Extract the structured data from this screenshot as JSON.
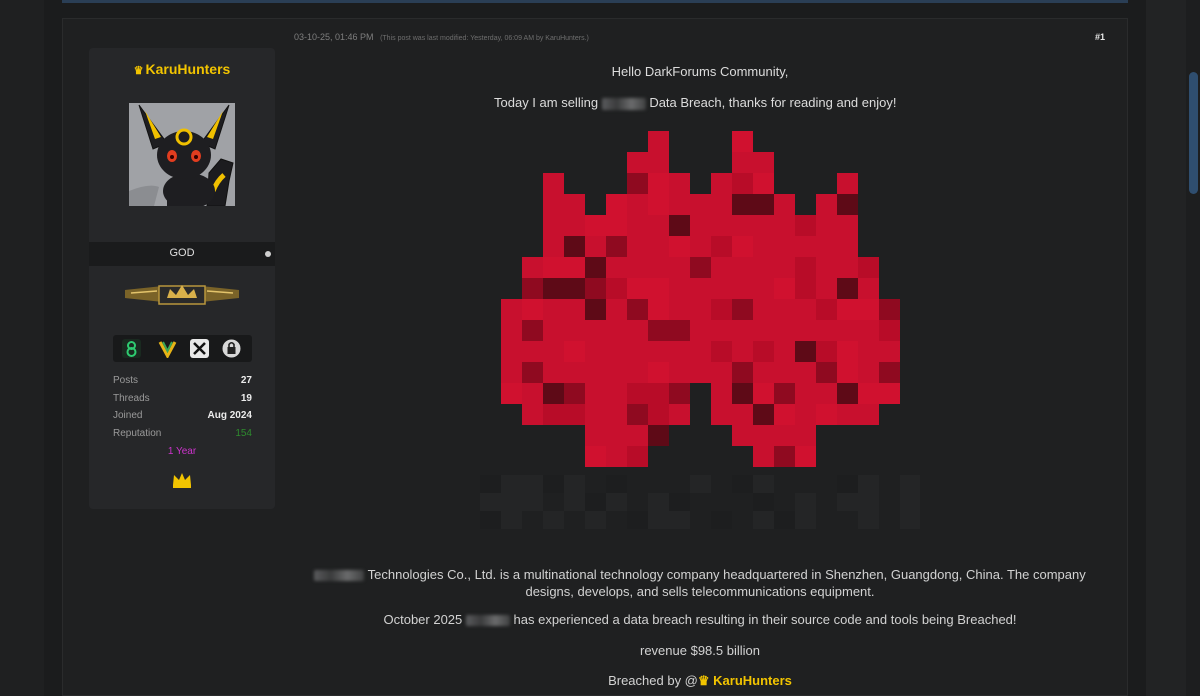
{
  "post": {
    "date": "03-10-25, 01:46 PM",
    "modified_note": "(This post was last modified: Yesterday, 06:09 AM by KaruHunters.)",
    "number": "#1"
  },
  "author": {
    "name_prefix": "♛",
    "name": "KaruHunters",
    "rank": "GOD",
    "stats": [
      {
        "label": "Posts",
        "value": "27"
      },
      {
        "label": "Threads",
        "value": "19"
      },
      {
        "label": "Joined",
        "value": "Aug 2024"
      },
      {
        "label": "Reputation",
        "value": "154"
      }
    ],
    "tenure": "1 Year",
    "reputation_color": "#2e8b2e",
    "name_color": "#f2c400",
    "tenure_color": "#cc33cc",
    "icons": [
      "avatar-umbreon",
      "rank-emblem",
      "badge-8",
      "badge-v",
      "badge-x",
      "badge-lock",
      "crown-icon"
    ]
  },
  "content": {
    "greeting": "Hello DarkForums Community,",
    "intro_before": "Today I am selling",
    "intro_after": "Data Breach, thanks for reading and enjoy!",
    "description": "Technologies Co., Ltd. is a multinational technology company headquartered in Shenzhen, Guangdong, China. The company designs, develops, and sells telecommunications equipment.",
    "breach_before": "October 2025",
    "breach_after": "has experienced a data breach resulting in their source code and tools being Breached!",
    "revenue": "revenue $98.5 billion",
    "breached_by": "Breached by @",
    "breached_handle": "♛ KaruHunters",
    "logo_color": "#c8102e"
  }
}
